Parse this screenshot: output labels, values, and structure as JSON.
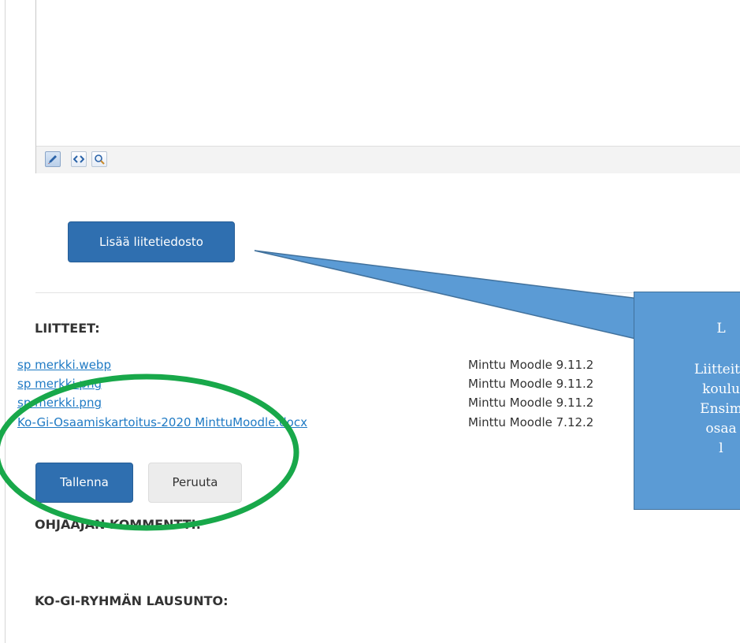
{
  "editor": {
    "toolbar": [
      {
        "name": "edit-pencil-icon"
      },
      {
        "name": "html-code-icon"
      },
      {
        "name": "zoom-magnifier-icon"
      }
    ]
  },
  "add_attachment_label": "Lisää liitetiedosto",
  "attachments": {
    "heading": "LIITTEET:",
    "items": [
      {
        "file": "sp merkki.webp",
        "meta": "Minttu Moodle 9.11.2"
      },
      {
        "file": "sp merkki.png",
        "meta": "Minttu Moodle 9.11.2"
      },
      {
        "file": "sp merkki.png",
        "meta": "Minttu Moodle 9.11.2"
      },
      {
        "file": "Ko-Gi-Osaamiskartoitus-2020 MinttuMoodle.docx",
        "meta": "Minttu Moodle 7.12.2"
      }
    ]
  },
  "actions": {
    "save_label": "Tallenna",
    "cancel_label": "Peruuta"
  },
  "sections": {
    "supervisor_comment": "OHJAAJAN KOMMENTTI:",
    "group_statement": "KO-GI-RYHMÄN LAUSUNTO:"
  },
  "callout": {
    "lines": [
      "L",
      "",
      "Liitteitä",
      "koulu",
      "Ensim",
      "osaa",
      "l"
    ]
  },
  "colors": {
    "primary_button": "#2f6fb0",
    "link": "#1f7ac4",
    "callout_fill": "#5b9bd5",
    "highlight_ellipse": "#18a84a"
  }
}
